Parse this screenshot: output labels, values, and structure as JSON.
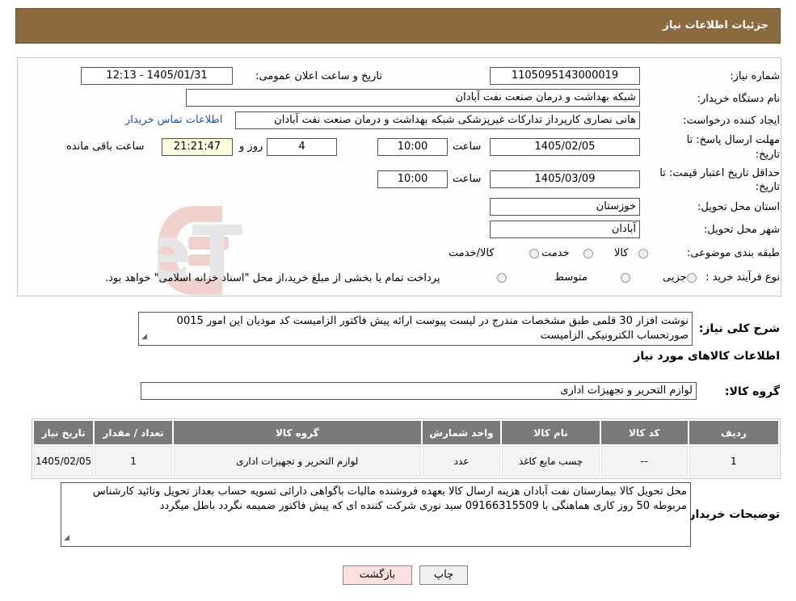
{
  "header": {
    "title": "جزئیات اطلاعات نیاز"
  },
  "form": {
    "need_number_label": "شماره نیاز:",
    "need_number": "1105095143000019",
    "announce_label": "تاریخ و ساعت اعلان عمومی:",
    "announce_value": "1405/01/31 - 12:13",
    "buyer_org_label": "نام دستگاه خریدار:",
    "buyer_org": "شبکه بهداشت و درمان صنعت نفت آبادان",
    "requester_label": "ایجاد کننده درخواست:",
    "requester": "هانی نصاری کارپرداز تدارکات غیرپزشکی شبکه بهداشت و درمان صنعت نفت آبادان",
    "contact_link": "اطلاعات تماس خریدار",
    "deadline_label_1": "مهلت ارسال پاسخ: تا",
    "deadline_label_2": "تاریخ:",
    "deadline_date": "1405/02/05",
    "time_label": "ساعت",
    "deadline_time": "10:00",
    "days_value": "4",
    "days_label": "روز و",
    "remaining_time": "21:21:47",
    "remaining_label": "ساعت باقی مانده",
    "validity_label_1": "حداقل تاریخ اعتبار قیمت: تا",
    "validity_label_2": "تاریخ:",
    "validity_date": "1405/03/09",
    "validity_time": "10:00",
    "province_label": "استان محل تحویل:",
    "province": "خوزستان",
    "city_label": "شهر محل تحویل:",
    "city": "آبادان",
    "category_label": "طبقه بندی موضوعی:",
    "category_options": [
      "کالا",
      "خدمت",
      "کالا/خدمت"
    ],
    "process_label": "نوع فرآیند خرید :",
    "process_options": [
      "جزیی",
      "متوسط"
    ],
    "process_note": "پرداخت تمام یا بخشی از مبلغ خرید،از محل \"اسناد خزانه اسلامی\" خواهد بود."
  },
  "watermark": {
    "text": "AriaTender.neT"
  },
  "description": {
    "label": "شرح کلی نیاز:",
    "text": "نوشت افزار 30 قلمی طبق مشخصات مندرج در لیست پیوست ارائه پیش فاکتور الزامیست کد مودیان این امور 0015 صورتحساب الکترونیکی الزامیست"
  },
  "goods_info_title": "اطلاعات کالاهای مورد نیاز",
  "goods_group": {
    "label": "گروه کالا:",
    "value": "لوازم التحریر و تجهیزات اداری"
  },
  "table": {
    "headers": [
      "ردیف",
      "کد کالا",
      "نام کالا",
      "واحد شمارش",
      "گروه کالا",
      "تعداد / مقدار",
      "تاریخ نیاز"
    ],
    "rows": [
      [
        "1",
        "--",
        "چسب مایع کاغذ",
        "عدد",
        "لوازم التحریر و تجهیزات اداری",
        "1",
        "1405/02/05"
      ]
    ]
  },
  "buyer_notes": {
    "label": "توضیحات خریدار:",
    "text": "محل تحویل کالا بیمارستان نفت آبادان هزینه ارسال کالا بعهده فروشنده مالیات باگواهی دارائی تسویه حساب بعداز تحویل وتائید کارشناس مربوطه 50 روز کاری هماهنگی با 09166315509  سید نوری شرکت کننده ای که پیش فاکتور ضمیمه نگردد باطل میگردد"
  },
  "buttons": {
    "print": "چاپ",
    "back": "بازگشت"
  },
  "colors": {
    "header_bg": "#8b6a3e",
    "link": "#1a4fd0",
    "table_header": "#7a7a7a",
    "back_button": "#ffe0e0"
  }
}
